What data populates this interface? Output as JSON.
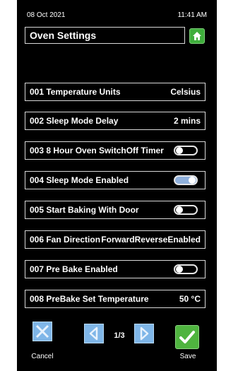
{
  "status": {
    "date": "08 Oct 2021",
    "time": "11:41 AM"
  },
  "header": {
    "title": "Oven Settings",
    "home_icon": "home-icon"
  },
  "settings": [
    {
      "label": "001 Temperature Units",
      "value": "Celsius",
      "control": "text"
    },
    {
      "label": "002 Sleep Mode Delay",
      "value": "2 mins",
      "control": "text"
    },
    {
      "label": "003 8 Hour Oven SwitchOff Timer",
      "toggle": "off",
      "control": "toggle"
    },
    {
      "label": "004 Sleep Mode Enabled",
      "toggle": "on",
      "control": "toggle"
    },
    {
      "label": "005 Start Baking With Door",
      "toggle": "off",
      "control": "toggle"
    },
    {
      "label": "006 Fan Direction",
      "value": "ForwardReverseEnabled",
      "control": "text"
    },
    {
      "label": "007 Pre Bake Enabled",
      "toggle": "off",
      "control": "toggle"
    },
    {
      "label": "008 PreBake Set Temperature",
      "value": "50 °C",
      "control": "text"
    }
  ],
  "footer": {
    "cancel_label": "Cancel",
    "page_indicator": "1/3",
    "save_label": "Save"
  },
  "colors": {
    "accent_blue": "#7fb6e8",
    "accent_green": "#4fb43f",
    "toggle_on": "#8fb0dc"
  }
}
